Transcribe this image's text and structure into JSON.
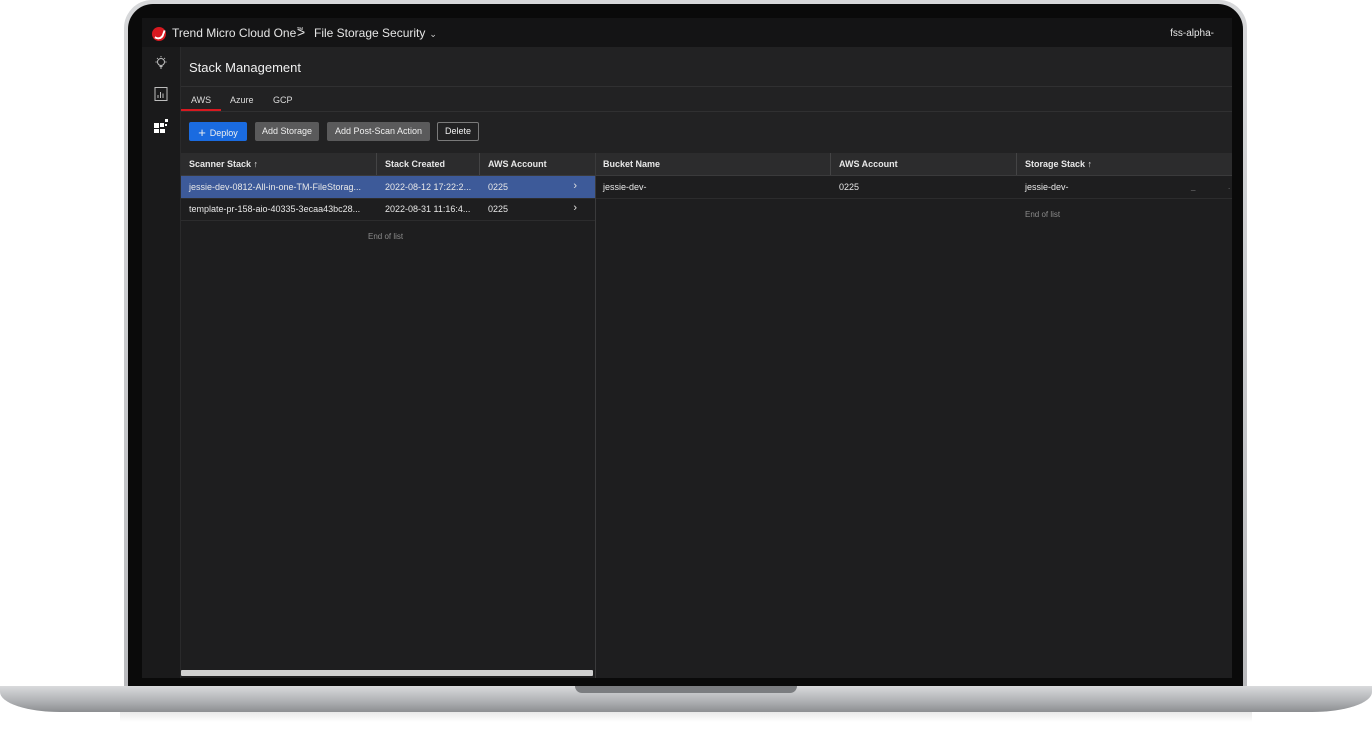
{
  "header": {
    "brand": "Trend Micro Cloud One",
    "trademark": "™",
    "separator": ">",
    "product": "File Storage Security",
    "product_chevron": "⌄",
    "account": "fss-alpha-"
  },
  "page": {
    "title": "Stack Management"
  },
  "tabs": [
    {
      "label": "AWS",
      "active": true
    },
    {
      "label": "Azure",
      "active": false
    },
    {
      "label": "GCP",
      "active": false
    }
  ],
  "toolbar": {
    "deploy_icon": "+",
    "deploy": "Deploy",
    "add_storage": "Add Storage",
    "add_post_scan": "Add Post-Scan Action",
    "delete": "Delete"
  },
  "scanner_table": {
    "headers": [
      "Scanner Stack ↑",
      "Stack Created",
      "AWS Account"
    ],
    "rows": [
      {
        "stack": "jessie-dev-0812-All-in-one-TM-FileStorag...",
        "created": "2022-08-12 17:22:2...",
        "account": "0225",
        "selected": true,
        "arrow": "›"
      },
      {
        "stack": "template-pr-158-aio-40335-3ecaa43bc28...",
        "created": "2022-08-31 11:16:4...",
        "account": "0225",
        "selected": false,
        "arrow": "›"
      }
    ],
    "end_text": "End of list"
  },
  "storage_table": {
    "headers": [
      "Bucket Name",
      "AWS Account",
      "Storage Stack ↑"
    ],
    "rows": [
      {
        "bucket": "jessie-dev-",
        "account": "0225",
        "stack": "jessie-dev-",
        "trail_a": "_",
        "trail_b": "."
      }
    ],
    "end_text": "End of list"
  },
  "colors": {
    "accent": "#d71920",
    "primary_button": "#1a6be0",
    "selected_row": "#3d5a99"
  },
  "icons": [
    "lightbulb-icon",
    "report-icon",
    "apps-grid-icon"
  ]
}
